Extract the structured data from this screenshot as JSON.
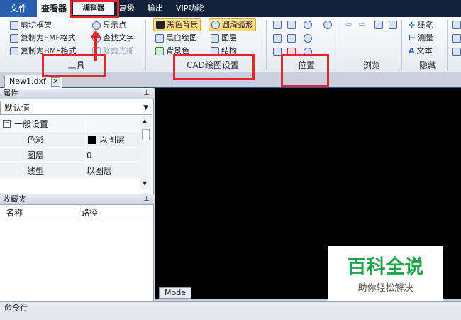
{
  "tabs": {
    "file": "文件",
    "viewer": "查看器",
    "editor": "编辑器",
    "advanced": "高级",
    "output": "输出",
    "vip": "VIP功能"
  },
  "ribbon": {
    "tools": {
      "label": "工具",
      "items": [
        "剪切框架",
        "复制为EMF格式",
        "复制为BMP格式",
        "显示点",
        "查找文字",
        "修剪光栅"
      ]
    },
    "cad_settings": {
      "label": "CAD绘图设置",
      "items": [
        "黑色背景",
        "黑白绘图",
        "背景色",
        "圆滑弧形",
        "图层",
        "结构"
      ]
    },
    "position": {
      "label": "位置"
    },
    "browse": {
      "label": "浏览"
    },
    "hide": {
      "label": "隐藏",
      "items": [
        "线宽",
        "测量",
        "文本"
      ]
    }
  },
  "document_tab": "New1.dxf",
  "properties": {
    "title": "属性",
    "dropdown_value": "默认值",
    "section": "一般设置",
    "rows": [
      {
        "name": "色彩",
        "value": "以图层"
      },
      {
        "name": "图层",
        "value": "0"
      },
      {
        "name": "线型",
        "value": "以图层"
      }
    ]
  },
  "favorites": {
    "title": "收藏夹",
    "columns": [
      "名称",
      "路径"
    ]
  },
  "model_tab": "Model",
  "command_line": "命令行",
  "watermark": {
    "title": "百科全说",
    "subtitle": "助你轻松解决"
  },
  "colors": {
    "annotation_red": "#e4262c",
    "canvas": "#000000",
    "watermark_green": "#20a64a",
    "file_tab": "#2a5fb0"
  }
}
